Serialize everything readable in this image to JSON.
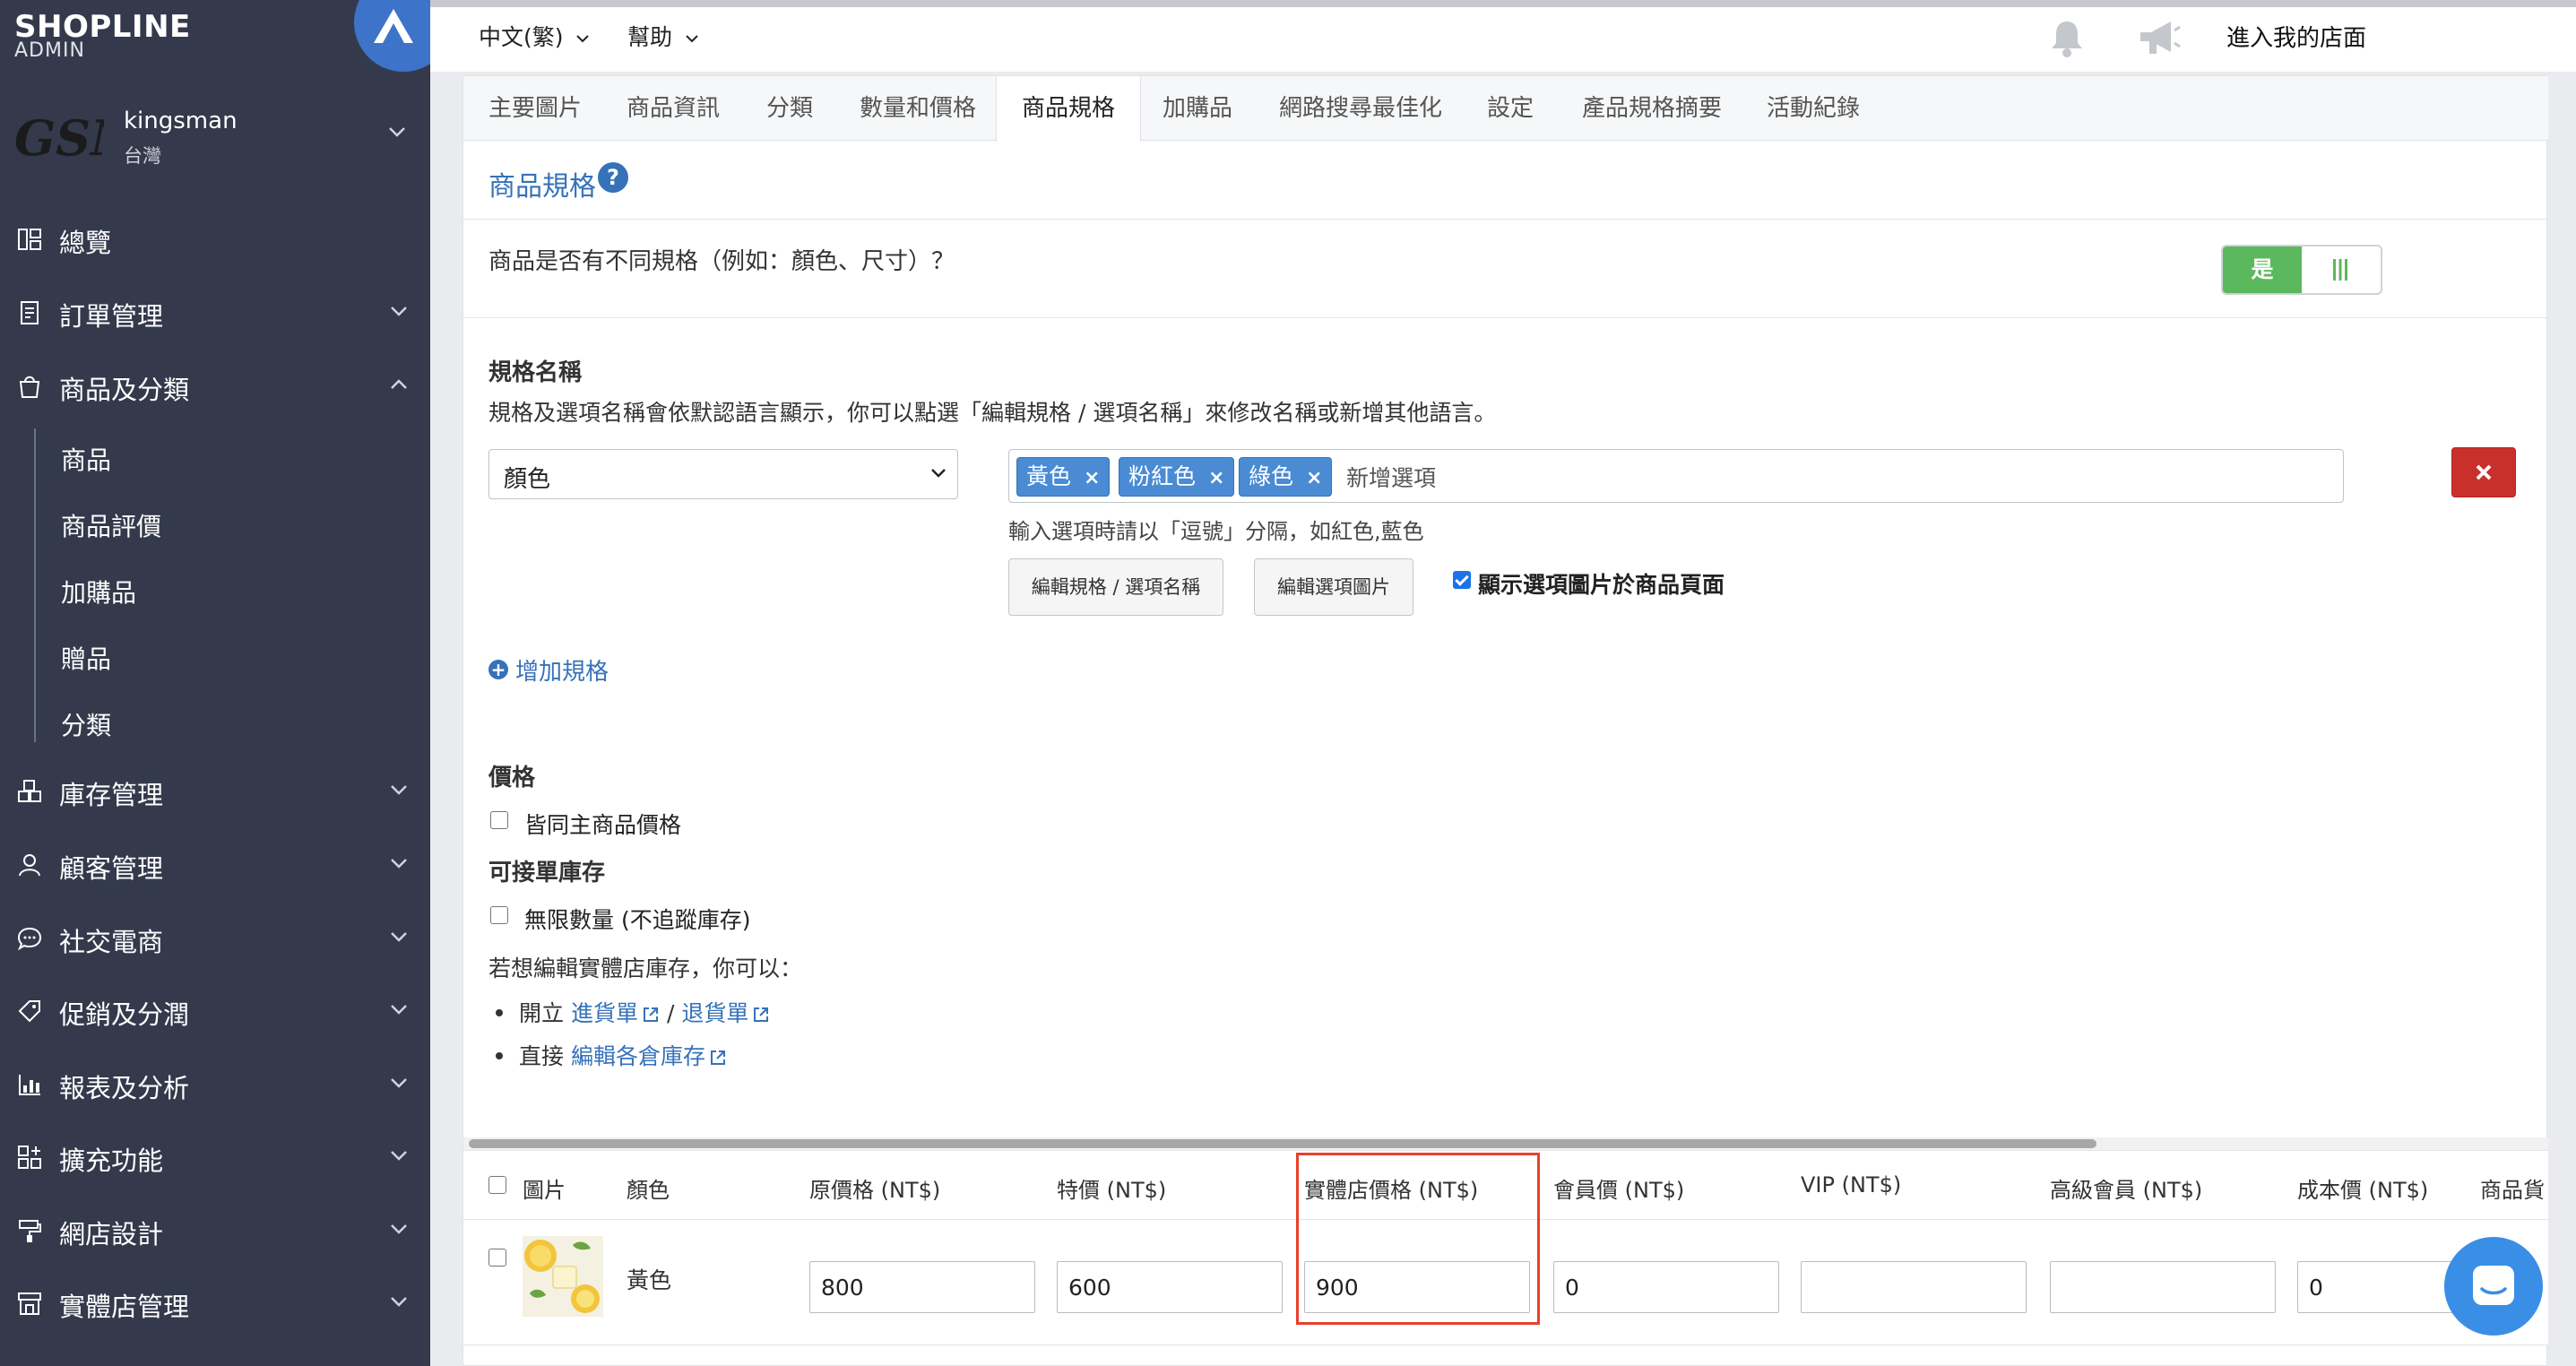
{
  "brand": {
    "logo": "SHOPLINE",
    "sub": "ADMIN"
  },
  "store": {
    "avatar": "GSM",
    "name": "kingsman",
    "region": "台灣"
  },
  "nav": {
    "overview": "總覽",
    "orders": "訂單管理",
    "products": "商品及分類",
    "sub": {
      "products": "商品",
      "reviews": "商品評價",
      "addons": "加購品",
      "gifts": "贈品",
      "categories": "分類"
    },
    "inventory": "庫存管理",
    "customers": "顧客管理",
    "social": "社交電商",
    "promotions": "促銷及分潤",
    "reports": "報表及分析",
    "apps": "擴充功能",
    "design": "網店設計",
    "retail": "實體店管理"
  },
  "topbar": {
    "language": "中文(繁)",
    "help": "幫助",
    "enter_store": "進入我的店面"
  },
  "tabs": [
    "主要圖片",
    "商品資訊",
    "分類",
    "數量和價格",
    "商品規格",
    "加購品",
    "網路搜尋最佳化",
    "設定",
    "產品規格摘要",
    "活動紀錄"
  ],
  "active_tab": "商品規格",
  "variations": {
    "title": "商品規格",
    "help": "?",
    "question": "商品是否有不同規格（例如：顏色、尺寸）？",
    "toggle_label": "是",
    "spec_name_label": "規格名稱",
    "spec_name_note": "規格及選項名稱會依默認語言顯示，你可以點選「編輯規格 / 選項名稱」來修改名稱或新增其他語言。",
    "spec_select": "顏色",
    "options": [
      "黃色",
      "粉紅色",
      "綠色"
    ],
    "option_placeholder": "新增選項",
    "option_hint": "輸入選項時請以「逗號」分隔，如紅色,藍色",
    "edit_names_btn": "編輯規格 / 選項名稱",
    "edit_images_btn": "編輯選項圖片",
    "show_images_label": "顯示選項圖片於商品頁面",
    "show_images_checked": true,
    "add_spec": "增加規格",
    "plus": "+"
  },
  "price": {
    "label": "價格",
    "same_as_main": "皆同主商品價格"
  },
  "stock": {
    "label": "可接單庫存",
    "unlimited": "無限數量 (不追蹤庫存)",
    "retail_note": "若想編輯實體店庫存，你可以：",
    "open_prefix": "開立",
    "purchase_order": "進貨單",
    "slash": "/",
    "return_order": "退貨單",
    "direct_prefix": "直接",
    "edit_warehouse": "編輯各倉庫存"
  },
  "table": {
    "headers": [
      "圖片",
      "顏色",
      "原價格 (NT$)",
      "特價 (NT$)",
      "實體店價格 (NT$)",
      "會員價 (NT$)",
      "VIP (NT$)",
      "高級會員 (NT$)",
      "成本價 (NT$)",
      "商品貨"
    ],
    "rows": [
      {
        "color": "黃色",
        "original": "800",
        "sale": "600",
        "retail": "900",
        "member": "0",
        "vip": "",
        "premium": "",
        "cost": "0"
      }
    ]
  },
  "colors": {
    "sidebar": "#343a4c",
    "accent": "#3572b9",
    "success": "#5cb85c",
    "danger": "#c9302c",
    "highlight": "#e8402a",
    "tag": "#4a8bd4"
  }
}
